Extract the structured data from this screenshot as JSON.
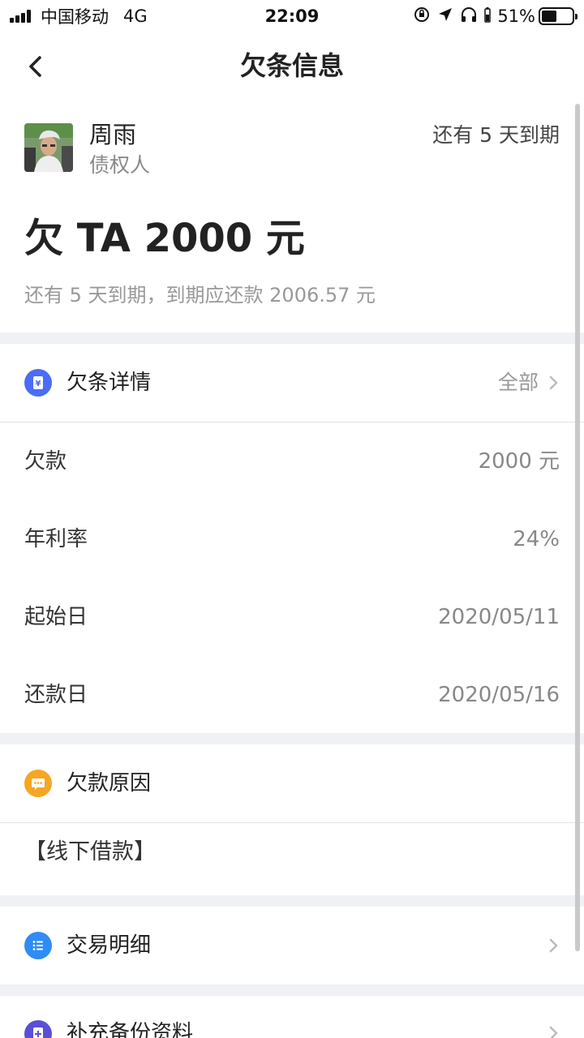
{
  "status_bar": {
    "carrier": "中国移动",
    "network": "4G",
    "time": "22:09",
    "battery_percent": "51%",
    "battery_level": 0.51,
    "icons": [
      "signal-icon",
      "orientation-lock-icon",
      "location-icon",
      "headphones-icon",
      "battery-icon"
    ]
  },
  "nav": {
    "title": "欠条信息",
    "back_icon": "chevron-left-icon"
  },
  "creditor": {
    "name": "周雨",
    "role": "债权人",
    "due_status": "还有 5 天到期"
  },
  "summary": {
    "owe_text": "欠 TA 2000 元",
    "due_desc": "还有 5 天到期，到期应还款 2006.57 元"
  },
  "details": {
    "title": "欠条详情",
    "more": "全部",
    "icon": "yuan-ticket-icon",
    "icon_color": "#4a6cf7",
    "rows": [
      {
        "label": "欠款",
        "value": "2000 元"
      },
      {
        "label": "年利率",
        "value": "24%"
      },
      {
        "label": "起始日",
        "value": "2020/05/11"
      },
      {
        "label": "还款日",
        "value": "2020/05/16"
      }
    ]
  },
  "reason": {
    "title": "欠款原因",
    "icon": "message-icon",
    "icon_color": "#f5a623",
    "text": "【线下借款】"
  },
  "transactions": {
    "title": "交易明细",
    "icon": "list-icon",
    "icon_color": "#2f8cf5"
  },
  "backup": {
    "title": "补充备份资料",
    "icon": "plus-doc-icon",
    "icon_color": "#5b4fd6"
  }
}
